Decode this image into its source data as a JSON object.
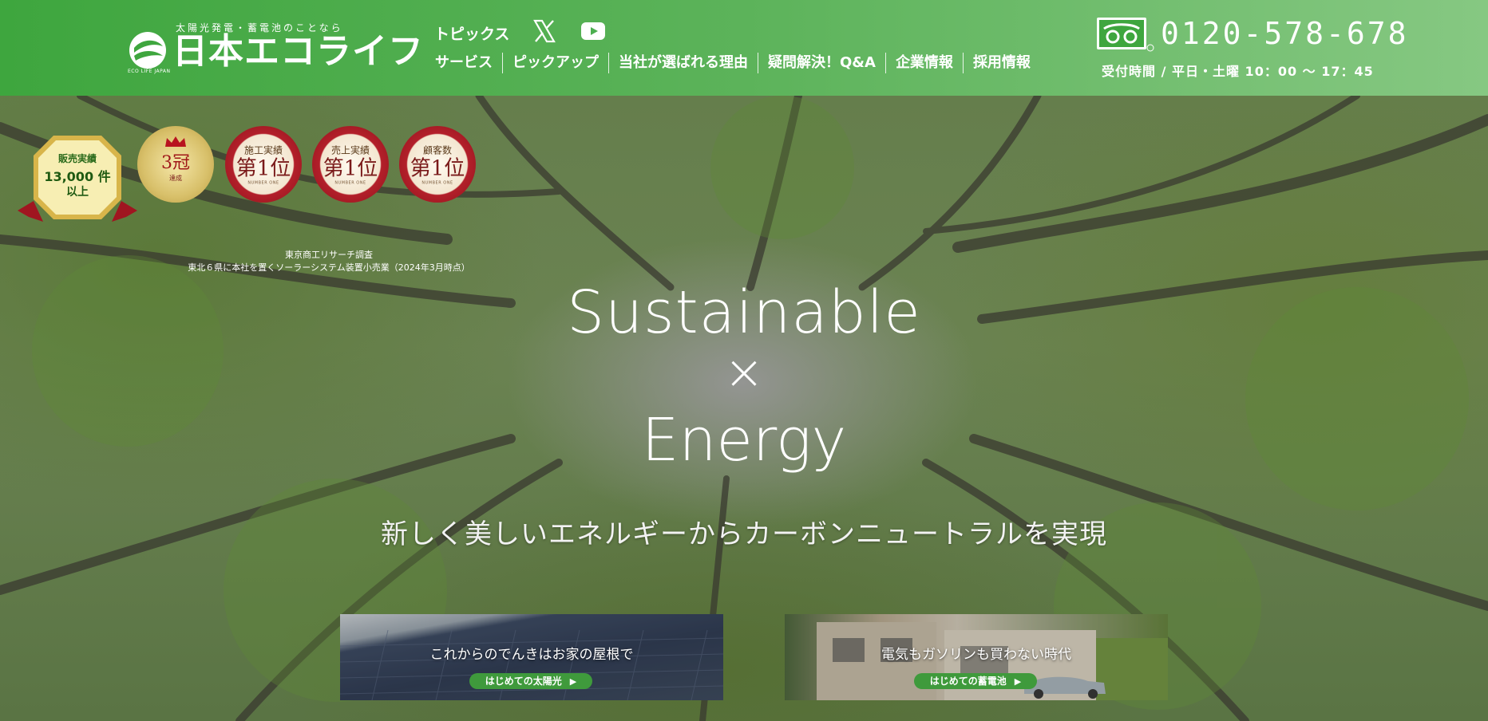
{
  "header": {
    "logo": {
      "tagline": "太陽光発電・蓄電池のことなら",
      "name": "日本エコライフ",
      "sub": "ECO LIFE JAPAN"
    },
    "topics_label": "トピックス",
    "social": {
      "x_icon": "x-icon",
      "youtube_icon": "youtube-icon"
    },
    "nav": [
      "サービス",
      "ピックアップ",
      "当社が選ばれる理由",
      "疑問解決！Q&A",
      "企業情報",
      "採用情報"
    ],
    "phone": "0120-578-678",
    "hours": "受付時間 / 平日・土曜 10：00 〜 17：45",
    "freedial_icon": "freedial-icon"
  },
  "badges": {
    "sales": {
      "line1": "販売実績",
      "line2": "13,000 件",
      "line3": "以上"
    },
    "crown": {
      "big": "3冠",
      "small": "達成"
    },
    "ranks": [
      {
        "label": "施工実績",
        "big": "第1位",
        "tiny": "NUMBER ONE"
      },
      {
        "label": "売上実績",
        "big": "第1位",
        "tiny": "NUMBER ONE"
      },
      {
        "label": "顧客数",
        "big": "第1位",
        "tiny": "NUMBER ONE"
      }
    ],
    "note_line1": "東京商工リサーチ調査",
    "note_line2": "東北６県に本社を置くソーラーシステム装置小売業（2024年3月時点）"
  },
  "hero": {
    "headline_1": "Sustainable",
    "headline_x": "×",
    "headline_2": "Energy",
    "tagline": "新しく美しいエネルギーからカーボンニュートラルを実現"
  },
  "cards": [
    {
      "title": "これからのでんきはお家の屋根で",
      "button": "はじめての太陽光"
    },
    {
      "title": "電気もガソリンも買わない時代",
      "button": "はじめての蓄電池"
    }
  ],
  "colors": {
    "header_start": "#3ea63e",
    "header_end": "#86c882",
    "button_green": "#3f9a3c"
  }
}
